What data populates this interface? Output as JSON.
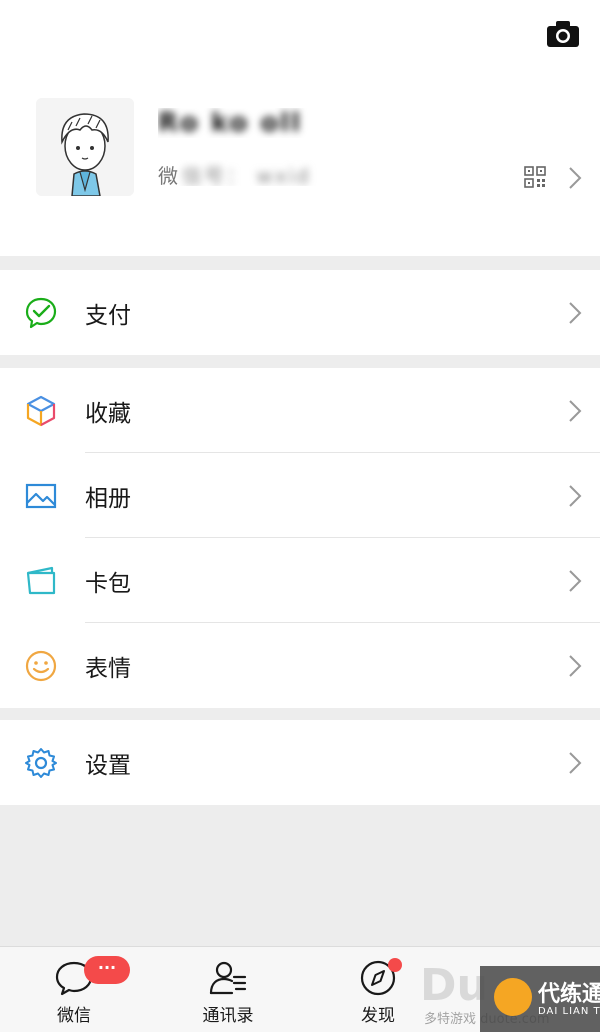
{
  "profile": {
    "nickname": "Ro ko oll",
    "wxid_label": "微",
    "wxid_value": "信号： wxid"
  },
  "menu": {
    "pay": "支付",
    "favorites": "收藏",
    "album": "相册",
    "cards": "卡包",
    "stickers": "表情",
    "settings": "设置"
  },
  "tabbar": {
    "chats": "微信",
    "contacts": "通讯录",
    "discover": "发现",
    "chats_badge": "···"
  },
  "watermark": {
    "big": "Du",
    "sub": "多特游戏 duote.com",
    "brand": "代练通",
    "brand_pinyin": "DAI LIAN TONG"
  },
  "colors": {
    "accent_green": "#07c160",
    "badge_red": "#f44a4a",
    "background": "#ededed"
  }
}
